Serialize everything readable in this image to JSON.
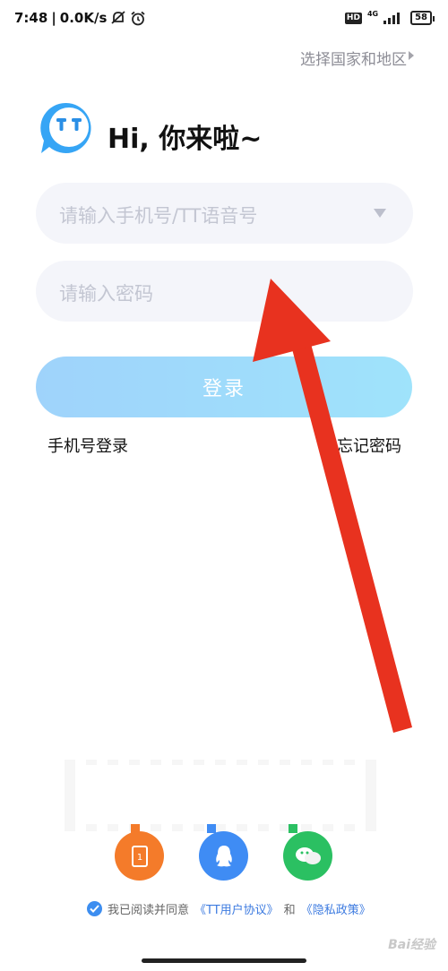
{
  "status_bar": {
    "time": "7:48",
    "speed": "0.0K/s",
    "hd": "HD",
    "network": "4G",
    "battery": "58"
  },
  "region": {
    "label": "选择国家和地区"
  },
  "greeting": "Hi, 你来啦~",
  "form": {
    "phone_placeholder": "请输入手机号/TT语音号",
    "password_placeholder": "请输入密码",
    "login_label": "登录"
  },
  "links": {
    "phone_login": "手机号登录",
    "forgot_password": "忘记密码"
  },
  "agreement": {
    "prefix": "我已阅读并同意",
    "user_agreement": "《TT用户协议》",
    "and": "和",
    "privacy": "《隐私政策》"
  },
  "watermark": "Bai经验",
  "colors": {
    "accent": "#3d8ef0",
    "login_button": "#9fd3fb",
    "orange_login": "#f47b2a",
    "qq_login": "#3f8cf4",
    "wechat_login": "#2bc062",
    "annotation_arrow": "#e8321f"
  },
  "icons": [
    "tt-logo-icon",
    "mute-icon",
    "alarm-icon",
    "signal-icon",
    "battery-icon",
    "tablet-login-icon",
    "qq-icon",
    "wechat-icon",
    "check-icon",
    "dropdown-icon",
    "triangle-right-icon"
  ]
}
